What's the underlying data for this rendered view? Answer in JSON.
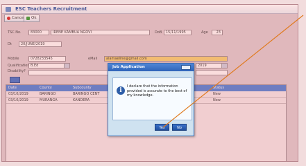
{
  "window": {
    "title": "ESC Teachers Recruitment"
  },
  "toolbar": {
    "cancel_label": "Cancel",
    "ok_label": "Ok"
  },
  "form": {
    "tsc_no_label": "TSC No.",
    "tsc_no_value": "83000",
    "name_value": "IRENE KAMBUA NGOVI",
    "dob_label": "DoB",
    "dob_value": "15/11/1995",
    "age_label": "Age",
    "age_value": "23",
    "date_label": "Dt",
    "date_value": "20/JUNE/2019",
    "mobile_label": "Mobile",
    "mobile_value": "0728233545",
    "email_label": "eMail",
    "email_value": "alamaeline@gmail.com",
    "qualification_label": "Qualification",
    "qualification_value": "B.Ed",
    "disability_label": "Disability?",
    "right_combo_value": "2019"
  },
  "grid": {
    "columns": [
      "Date",
      "County",
      "Subcounty",
      "",
      "",
      "Status"
    ],
    "rows": [
      {
        "date": "03/10/2019",
        "county": "BARINGO",
        "subcounty": "BARINGO CENT",
        "status": "New"
      },
      {
        "date": "03/10/2019",
        "county": "MURANGA",
        "subcounty": "KANDERA",
        "status": "New"
      }
    ]
  },
  "dialog": {
    "title": "Job Application",
    "message": "I declare that the information provided is accurate to the best of my knowledge.",
    "yes_label": "Yes",
    "no_label": "No"
  },
  "colors": {
    "overlay": "#f08282",
    "pointer_line": "#e07a1e",
    "dialog_title": "#2f63b8",
    "grid_header": "#4a7bd2",
    "email_field": "#f3cc6e"
  }
}
